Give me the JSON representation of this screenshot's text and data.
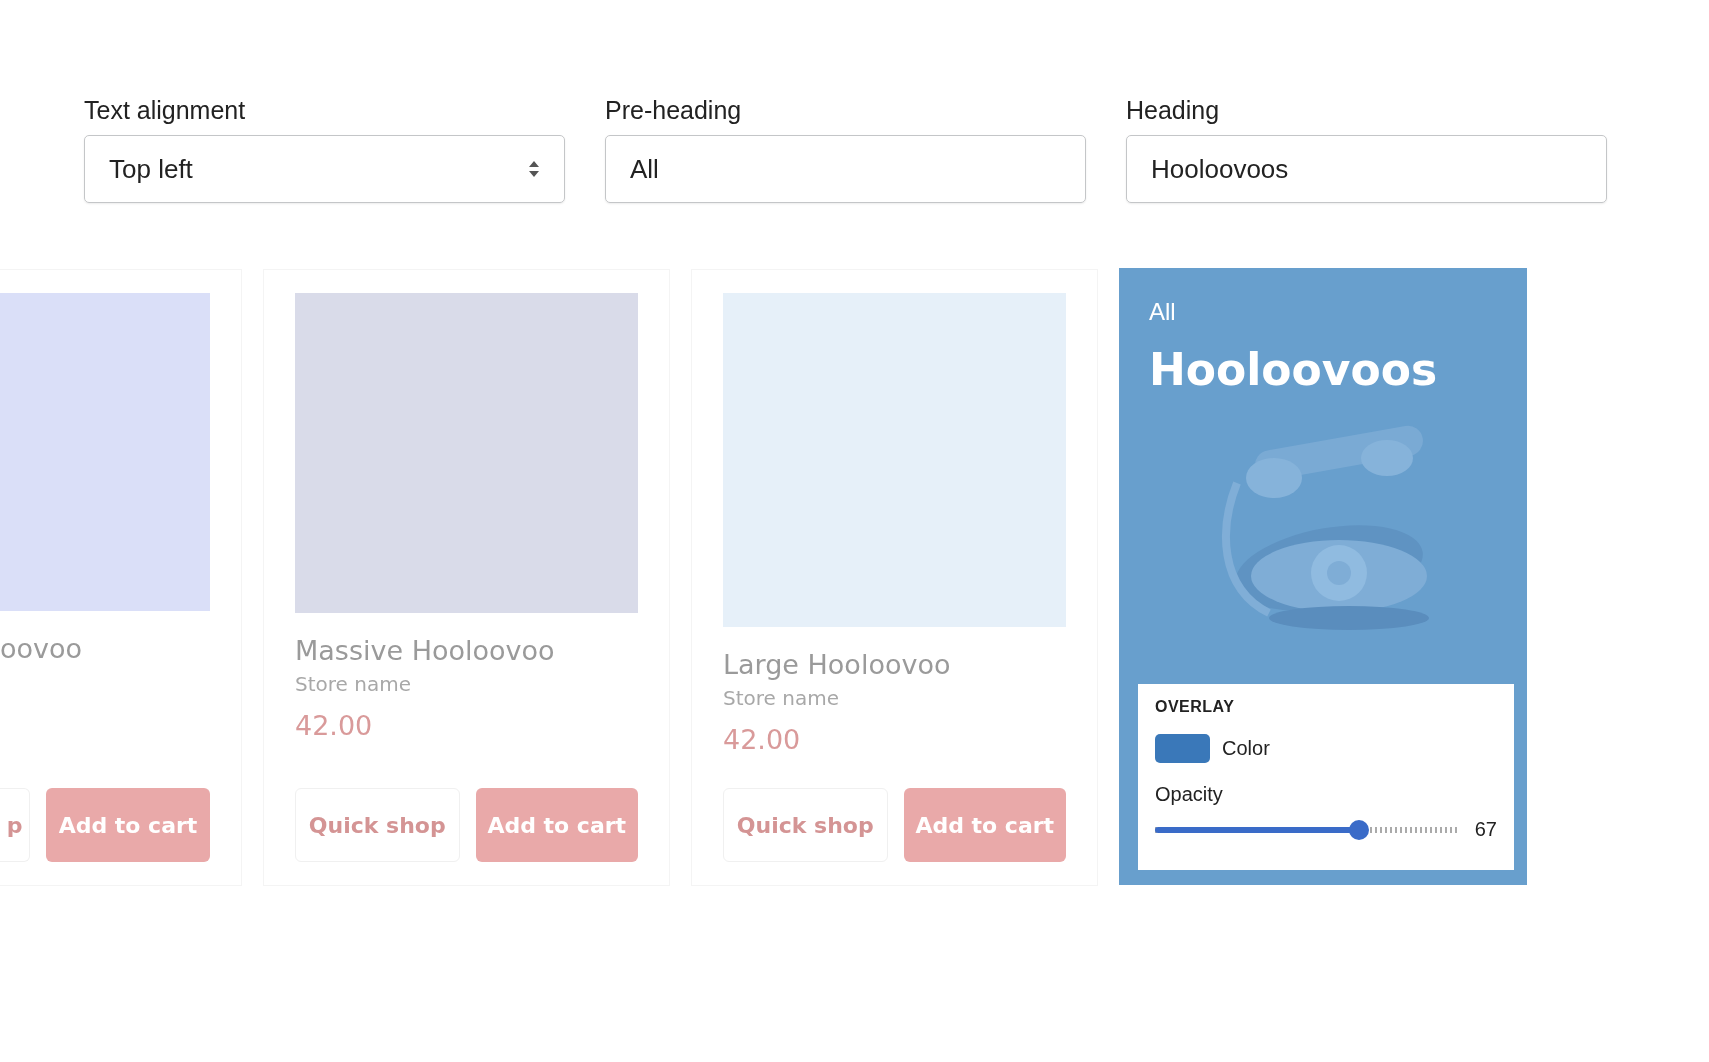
{
  "fields": [
    {
      "kind": "select",
      "label": "Text alignment",
      "value": "Top left"
    },
    {
      "kind": "text",
      "label": "Pre-heading",
      "value": "All"
    },
    {
      "kind": "text",
      "label": "Heading",
      "value": "Hooloovoos"
    }
  ],
  "products": [
    {
      "title": "oovoo",
      "quick_shop": "p",
      "add_to_cart": "Add to cart"
    },
    {
      "title": "Massive Hooloovoo",
      "store": "Store name",
      "price": "42.00",
      "quick_shop": "Quick shop",
      "add_to_cart": "Add to cart"
    },
    {
      "title": "Large Hooloovoo",
      "store": "Store name",
      "price": "42.00",
      "quick_shop": "Quick shop",
      "add_to_cart": "Add to cart"
    }
  ],
  "banner": {
    "pre_heading": "All",
    "heading": "Hooloovoos",
    "overlay": {
      "title": "OVERLAY",
      "color_label": "Color",
      "color": "#3a78b9",
      "opacity_label": "Opacity",
      "level": 0.67,
      "reading": "67"
    }
  }
}
